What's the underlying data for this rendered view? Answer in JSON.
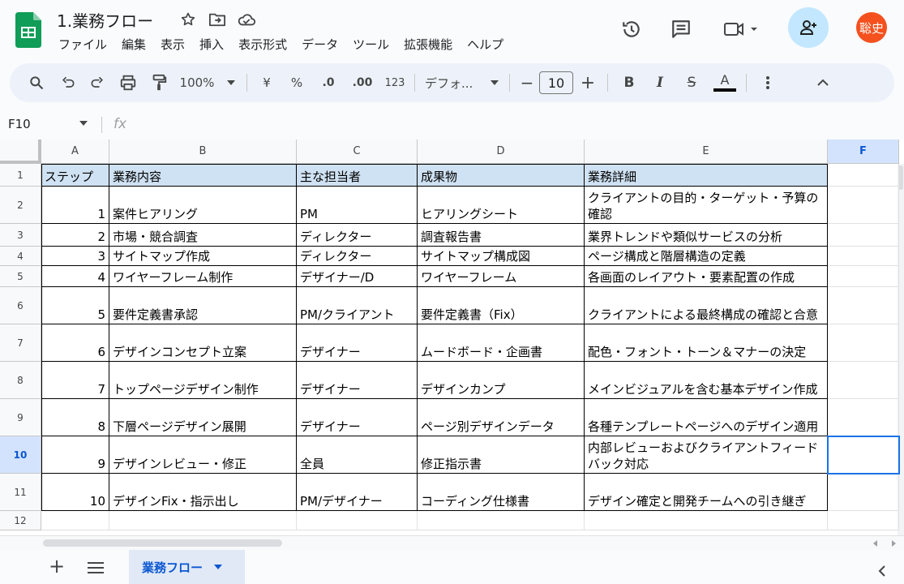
{
  "app": {
    "title": "1.業務フロー",
    "menu": [
      "ファイル",
      "編集",
      "表示",
      "挿入",
      "表示形式",
      "データ",
      "ツール",
      "拡張機能",
      "ヘルプ"
    ],
    "avatar_text": "聡史",
    "accent": "#0b57d0",
    "share_bg": "#c2e7ff",
    "avatar_bg": "#f4511e"
  },
  "toolbar": {
    "zoom": "100%",
    "currency": "¥",
    "percent": "%",
    "dec_decrease": ".0",
    "dec_increase": ".00",
    "number_format": "123",
    "font": "デフォ...",
    "minus": "−",
    "font_size": "10",
    "plus": "+",
    "bold": "B",
    "italic": "I",
    "strike": "S",
    "text_color": "A"
  },
  "formula": {
    "cell_ref": "F10",
    "fx": "fx",
    "value": ""
  },
  "columns": [
    "A",
    "B",
    "C",
    "D",
    "E",
    "F"
  ],
  "rows": [
    "1",
    "2",
    "3",
    "4",
    "5",
    "6",
    "7",
    "8",
    "9",
    "10",
    "11",
    "12"
  ],
  "table": {
    "header": [
      "ステップ",
      "業務内容",
      "主な担当者",
      "成果物",
      "業務詳細"
    ],
    "body": [
      [
        "1",
        "案件ヒアリング",
        "PM",
        "ヒアリングシート",
        "クライアントの目的・ターゲット・予算の確認"
      ],
      [
        "2",
        "市場・競合調査",
        "ディレクター",
        "調査報告書",
        "業界トレンドや類似サービスの分析"
      ],
      [
        "3",
        "サイトマップ作成",
        "ディレクター",
        "サイトマップ構成図",
        "ページ構成と階層構造の定義"
      ],
      [
        "4",
        "ワイヤーフレーム制作",
        "デザイナー/D",
        "ワイヤーフレーム",
        "各画面のレイアウト・要素配置の作成"
      ],
      [
        "5",
        "要件定義書承認",
        "PM/クライアント",
        "要件定義書（Fix）",
        "クライアントによる最終構成の確認と合意"
      ],
      [
        "6",
        "デザインコンセプト立案",
        "デザイナー",
        "ムードボード・企画書",
        "配色・フォント・トーン＆マナーの決定"
      ],
      [
        "7",
        "トップページデザイン制作",
        "デザイナー",
        "デザインカンプ",
        "メインビジュアルを含む基本デザイン作成"
      ],
      [
        "8",
        "下層ページデザイン展開",
        "デザイナー",
        "ページ別デザインデータ",
        "各種テンプレートページへのデザイン適用"
      ],
      [
        "9",
        "デザインレビュー・修正",
        "全員",
        "修正指示書",
        " 内部レビューおよびクライアントフィードバック対応"
      ],
      [
        "10",
        "デザインFix・指示出し",
        "PM/デザイナー",
        "コーディング仕様書",
        "デザイン確定と開発チームへの引き継ぎ"
      ]
    ]
  },
  "sheet": {
    "add": "+",
    "tab_label": "業務フロー"
  }
}
